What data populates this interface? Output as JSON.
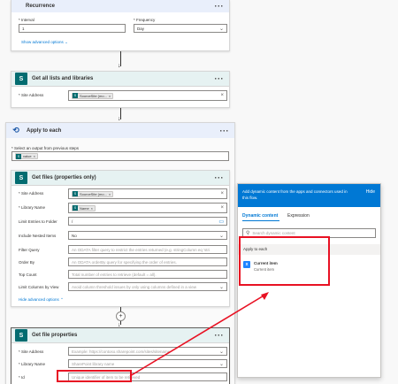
{
  "recurrence": {
    "title": "Recurrence",
    "interval_label": "* Interval",
    "interval_value": "1",
    "frequency_label": "* Frequency",
    "frequency_value": "Day",
    "show_advanced": "Show advanced options"
  },
  "get_lists": {
    "title": "Get all lists and libraries",
    "site_label": "* Site Address",
    "site_token": "SourceSite (mo..."
  },
  "apply_each": {
    "title": "Apply to each",
    "select_label": "* Select an output from previous steps",
    "value_token": "value"
  },
  "get_files": {
    "title": "Get files (properties only)",
    "site_label": "* Site Address",
    "site_token": "SourceSite (mo...",
    "library_label": "* Library Name",
    "library_token": "Name",
    "limit_folder_label": "Limit Entries to Folder",
    "limit_folder_value": "/",
    "nested_label": "Include Nested Items",
    "nested_value": "No",
    "filter_label": "Filter Query",
    "filter_placeholder": "An ODATA filter query to restrict the entries returned (e.g. stringColumn eq 'stri",
    "order_label": "Order By",
    "order_placeholder": "An ODATA orderBy query for specifying the order of entries.",
    "top_label": "Top Count",
    "top_placeholder": "Total number of entries to retrieve (default = all).",
    "limit_cols_label": "Limit Columns by View",
    "limit_cols_placeholder": "Avoid column threshold issues by only using columns defined in a view",
    "hide_advanced": "Hide advanced options"
  },
  "get_props": {
    "title": "Get file properties",
    "site_label": "* Site Address",
    "site_placeholder": "Example: https://contoso.sharepoint.com/sites/sitename",
    "library_label": "* Library Name",
    "library_placeholder": "SharePoint library name",
    "id_label": "* Id",
    "id_placeholder": "Unique identifier of item to be retrieved"
  },
  "dynamic": {
    "header_text": "Add dynamic content from the apps and connectors used in this flow.",
    "hide": "Hide",
    "tab_dynamic": "Dynamic content",
    "tab_expression": "Expression",
    "search_placeholder": "Search dynamic content",
    "section": "Apply to each",
    "item_title": "Current item",
    "item_subtitle": "Current item"
  },
  "colors": {
    "accent": "#0078d4",
    "sharepoint": "#036c70",
    "highlight": "#e81123"
  }
}
